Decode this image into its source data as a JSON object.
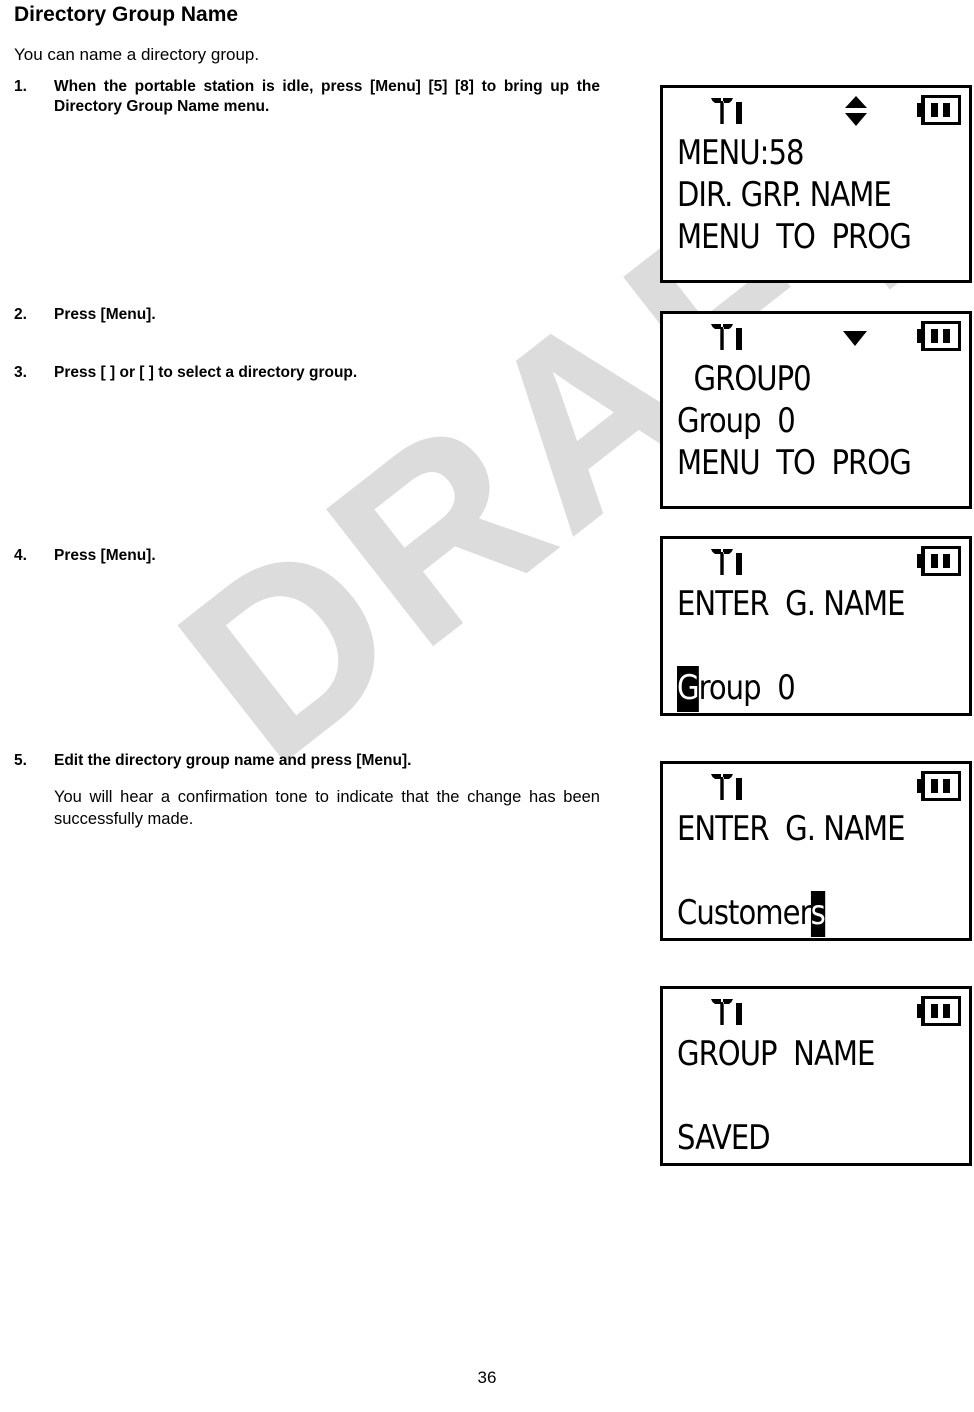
{
  "document": {
    "title": "Directory Group Name",
    "intro": "You can name a directory group.",
    "page_number": "36",
    "watermark": "DRAFT",
    "watermark_color": "#dcdcdc"
  },
  "steps": [
    {
      "number": "1.",
      "text": "When the portable station is idle, press [Menu] [5] [8] to bring up the Directory Group Name menu."
    },
    {
      "number": "2.",
      "text": "Press [Menu]."
    },
    {
      "number": "3.",
      "text": "Press [   ] or [   ] to select a directory group."
    },
    {
      "number": "4.",
      "text": "Press [Menu]."
    },
    {
      "number": "5.",
      "text": "Edit the directory group name and press [Menu].",
      "note": "You will hear a confirmation tone to indicate that the change has been successfully made."
    }
  ],
  "lcd_screens": [
    {
      "id": "screen-menu-58",
      "icons": {
        "signal": "antenna-icon",
        "indicator": "up-down-arrows-icon",
        "battery": "battery-icon"
      },
      "lines": [
        "MENU:58",
        "DIR. GRP. NAME",
        "MENU  TO  PROG"
      ]
    },
    {
      "id": "screen-group-select",
      "icons": {
        "signal": "antenna-icon",
        "indicator": "down-arrow-icon",
        "battery": "battery-icon"
      },
      "lines": [
        "  GROUP0",
        "Group  0",
        "MENU  TO  PROG"
      ]
    },
    {
      "id": "screen-enter-name-default",
      "icons": {
        "signal": "antenna-icon",
        "indicator": "none",
        "battery": "battery-icon"
      },
      "lines": [
        "ENTER  G. NAME",
        "",
        "Group  0"
      ],
      "cursor_line": 2,
      "cursor_char": "G",
      "cursor_rest": "roup  0"
    },
    {
      "id": "screen-enter-name-customers",
      "icons": {
        "signal": "antenna-icon",
        "indicator": "none",
        "battery": "battery-icon"
      },
      "lines": [
        "ENTER  G. NAME",
        "",
        "Customers"
      ],
      "cursor_line": 2,
      "cursor_prefix": "Customer",
      "cursor_char": "s"
    },
    {
      "id": "screen-group-name-saved",
      "icons": {
        "signal": "antenna-icon",
        "indicator": "none",
        "battery": "battery-icon"
      },
      "lines": [
        "GROUP  NAME",
        "",
        "SAVED"
      ]
    }
  ]
}
